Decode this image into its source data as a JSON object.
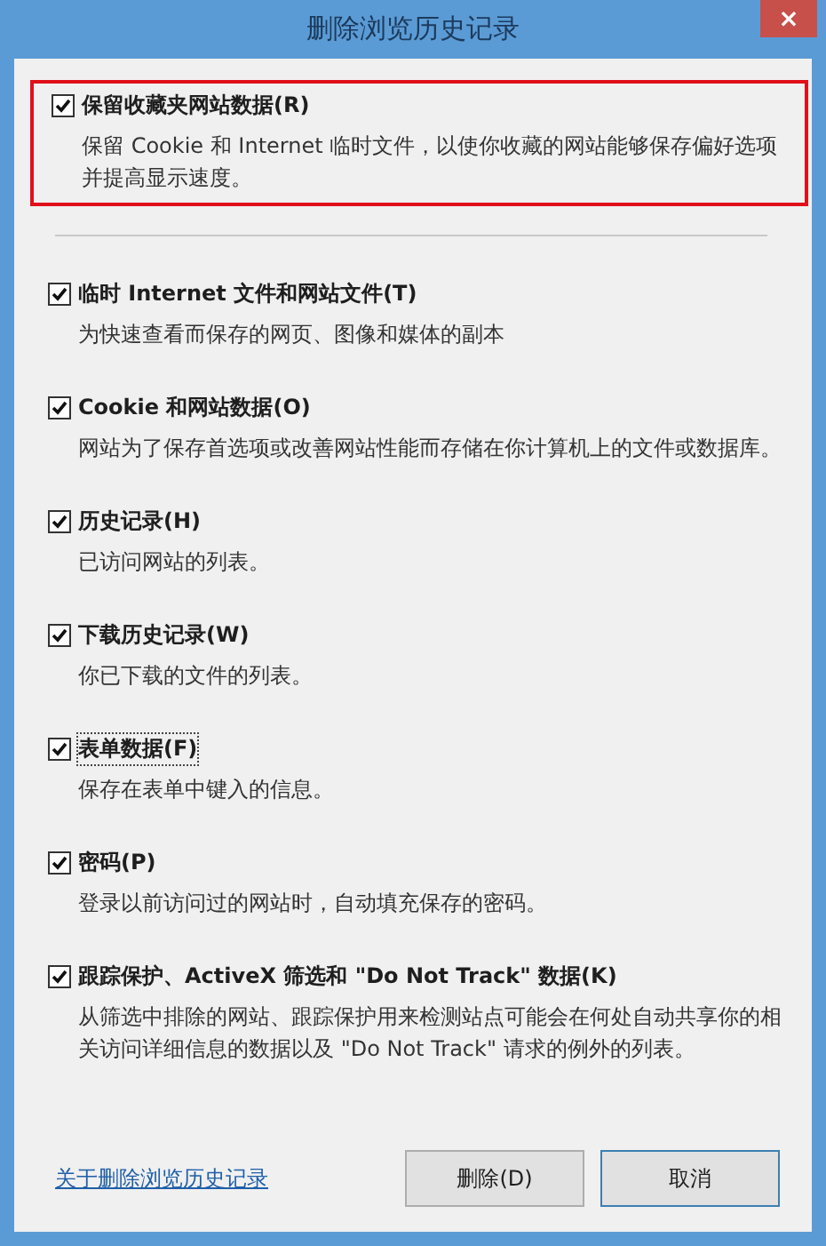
{
  "window": {
    "title": "删除浏览历史记录",
    "close": "×"
  },
  "options": [
    {
      "label": "保留收藏夹网站数据(R)",
      "description": "保留 Cookie 和 Internet 临时文件，以使你收藏的网站能够保存偏好选项并提高显示速度。",
      "checked": true,
      "highlighted": true,
      "focused": false
    },
    {
      "label": "临时 Internet 文件和网站文件(T)",
      "description": "为快速查看而保存的网页、图像和媒体的副本",
      "checked": true,
      "highlighted": false,
      "focused": false
    },
    {
      "label": "Cookie 和网站数据(O)",
      "description": "网站为了保存首选项或改善网站性能而存储在你计算机上的文件或数据库。",
      "checked": true,
      "highlighted": false,
      "focused": false
    },
    {
      "label": "历史记录(H)",
      "description": "已访问网站的列表。",
      "checked": true,
      "highlighted": false,
      "focused": false
    },
    {
      "label": "下载历史记录(W)",
      "description": "你已下载的文件的列表。",
      "checked": true,
      "highlighted": false,
      "focused": false
    },
    {
      "label": "表单数据(F)",
      "description": "保存在表单中键入的信息。",
      "checked": true,
      "highlighted": false,
      "focused": true
    },
    {
      "label": "密码(P)",
      "description": "登录以前访问过的网站时，自动填充保存的密码。",
      "checked": true,
      "highlighted": false,
      "focused": false
    },
    {
      "label": "跟踪保护、ActiveX 筛选和 \"Do Not Track\" 数据(K)",
      "description": "从筛选中排除的网站、跟踪保护用来检测站点可能会在何处自动共享你的相关访问详细信息的数据以及 \"Do Not Track\" 请求的例外的列表。",
      "checked": true,
      "highlighted": false,
      "focused": false
    }
  ],
  "footer": {
    "link": "关于删除浏览历史记录",
    "buttons": [
      {
        "label": "删除(D)",
        "kind": "normal"
      },
      {
        "label": "取消",
        "kind": "default"
      }
    ]
  }
}
